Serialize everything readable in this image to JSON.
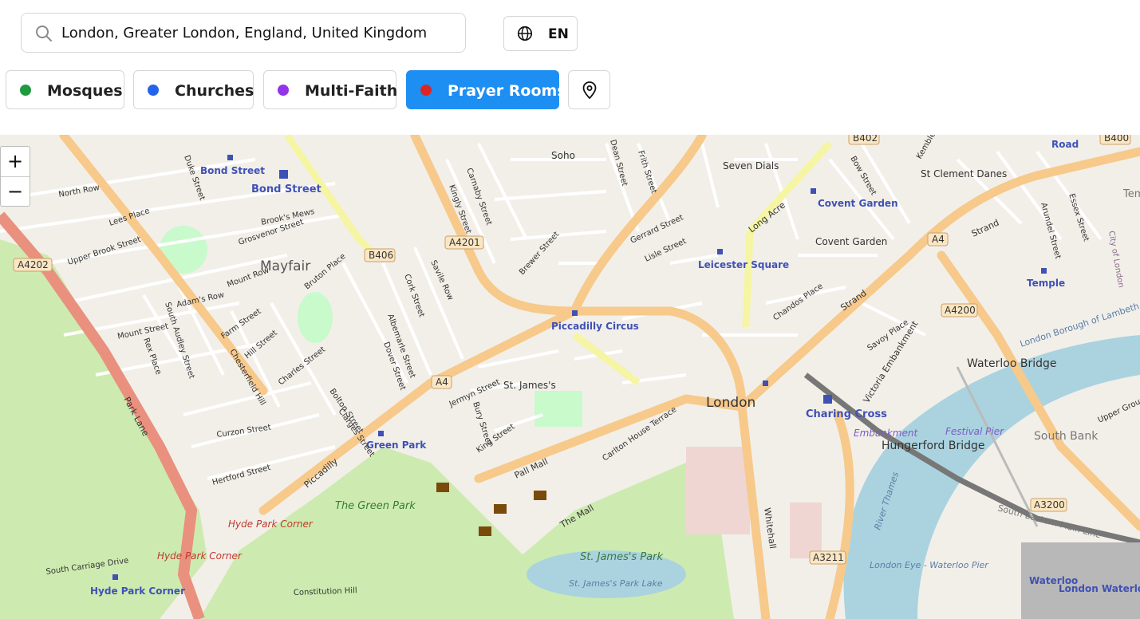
{
  "search": {
    "value": "London, Greater London, England, United Kingdom"
  },
  "language": {
    "label": "EN"
  },
  "filters": [
    {
      "label": "Mosques",
      "color": "#1f9a3f",
      "active": false
    },
    {
      "label": "Churches",
      "color": "#2563eb",
      "active": false
    },
    {
      "label": "Multi-Faith",
      "color": "#9333ea",
      "active": false
    },
    {
      "label": "Prayer Rooms",
      "color": "#dc2626",
      "active": true
    }
  ],
  "map": {
    "zoom_in": "+",
    "zoom_out": "−",
    "labels": {
      "bond_street_1": "Bond Street",
      "bond_street_2": "Bond Street",
      "soho": "Soho",
      "seven_dials": "Seven Dials",
      "st_clement_danes": "St Clement Danes",
      "covent_garden_station": "Covent Garden",
      "covent_garden": "Covent Garden",
      "mayfair": "Mayfair",
      "leicester_square": "Leicester Square",
      "temple": "Temple",
      "piccadilly_circus": "Piccadilly Circus",
      "waterloo_bridge": "Waterloo Bridge",
      "st_james": "St. James's",
      "london": "London",
      "charing_cross": "Charing Cross",
      "embankment": "Embankment",
      "hungerford_bridge": "Hungerford Bridge",
      "festival_pier": "Festival Pier",
      "south_bank": "South Bank",
      "green_park": "Green Park",
      "green_park_area": "The Green Park",
      "hyde_park_corner_1": "Hyde Park Corner",
      "hyde_park_corner_2": "Hyde Park Corner",
      "hyde_park_corner_station": "Hyde Park Corner",
      "st_james_park": "St. James's Park",
      "st_james_park_lake": "St. James's Park Lake",
      "london_eye_pier": "London Eye - Waterloo Pier",
      "waterloo": "Waterloo",
      "london_waterloo": "London Waterloo",
      "park_lane": "Park Lane",
      "piccadilly": "Piccadilly",
      "pall_mall": "Pall Mall",
      "the_mall": "The Mall",
      "whitehall": "Whitehall",
      "strand_1": "Strand",
      "strand_2": "Strand",
      "long_acre": "Long Acre",
      "victoria_embankment": "Victoria Embankment",
      "river_thames": "River Thames",
      "london_borough_lambeth": "London Borough of Lambeth",
      "south_eastern_main_line": "South Eastern Main Line",
      "north_row": "North Row",
      "upper_brook_street": "Upper Brook Street",
      "grosvenor_street": "Grosvenor Street",
      "brooks_mews": "Brook's Mews",
      "mount_row": "Mount Row",
      "adams_row": "Adam's Row",
      "mount_street": "Mount Street",
      "south_audley_street": "South Audley Street",
      "farm_street": "Farm Street",
      "hill_street": "Hill Street",
      "charles_street": "Charles Street",
      "curzon_street": "Curzon Street",
      "hertford_street": "Hertford Street",
      "bolton_street": "Bolton Street",
      "clarges_street": "Clarges Street",
      "dover_street": "Dover Street",
      "albemarle_street": "Albemarle Street",
      "cork_street": "Cork Street",
      "savile_row": "Savile Row",
      "bruton_place": "Bruton Place",
      "kingly_street": "Kingly Street",
      "carnaby_street": "Carnaby Street",
      "brewer_street": "Brewer Street",
      "dean_street": "Dean Street",
      "frith_street": "Frith Street",
      "gerrard_street": "Gerrard Street",
      "lisle_street": "Lisle Street",
      "chandos_place": "Chandos Place",
      "savoy_place": "Savoy Place",
      "bow_street": "Bow Street",
      "arundel_street": "Arundel Street",
      "essex_street": "Essex Street",
      "jermyn_street": "Jermyn Street",
      "bury_street": "Bury Street",
      "king_street": "King Street",
      "carlton_house_terrace": "Carlton House Terrace",
      "south_carriage_drive": "South Carriage Drive",
      "constitution_hill": "Constitution Hill",
      "upper_ground": "Upper Ground",
      "road": "Road",
      "duke_street": "Duke Street",
      "lees_place": "Lees Place",
      "farm_chesterfield": "Chesterfield Hill",
      "rex_place": "Rex Place",
      "kemble_st": "Kemble St",
      "city_of_london": "City of London",
      "tem": "Tem"
    },
    "shields": {
      "b402": "B402",
      "b400": "B400",
      "a4202": "A4202",
      "b406": "B406",
      "a4201": "A4201",
      "a4_1": "A4",
      "a4_2": "A4",
      "a4200": "A4200",
      "a3200": "A3200",
      "a3211": "A3211"
    }
  }
}
